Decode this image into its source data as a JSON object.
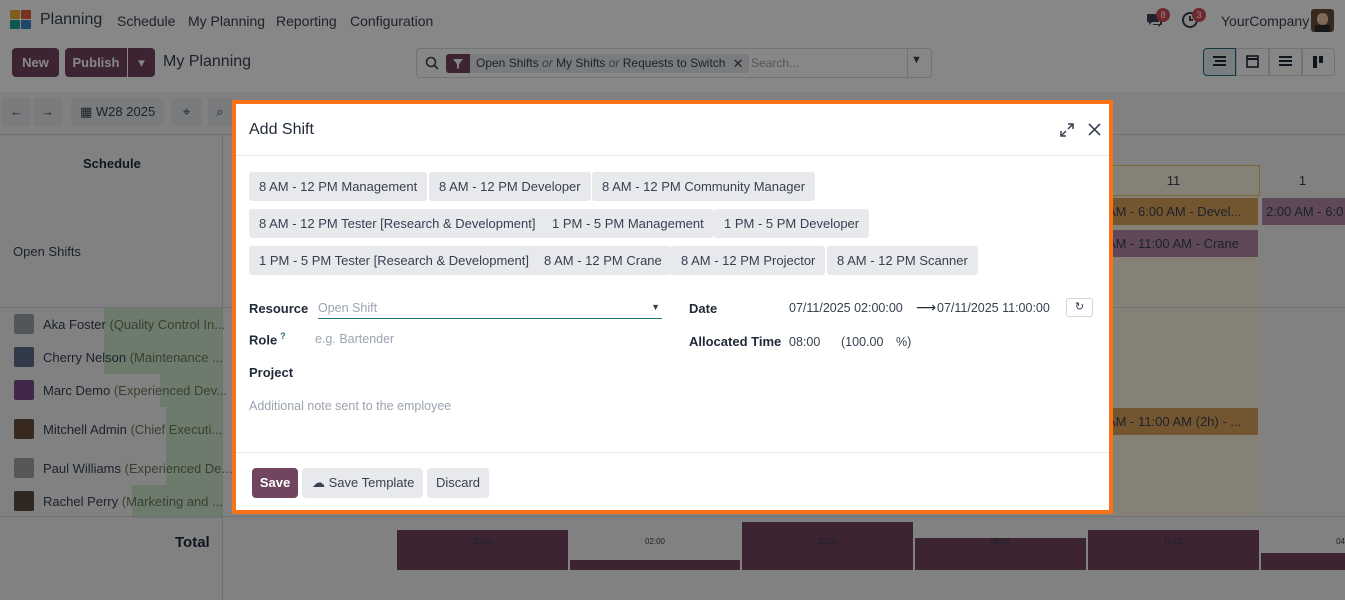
{
  "nav": {
    "app_name": "Planning",
    "menu": [
      "Schedule",
      "My Planning",
      "Reporting",
      "Configuration"
    ],
    "messages_badge": "8",
    "activities_badge": "3",
    "company": "YourCompany"
  },
  "control_panel": {
    "new_label": "New",
    "publish_label": "Publish",
    "breadcrumb": "My Planning",
    "facet": {
      "a": "Open Shifts",
      "or1": "or",
      "b": "My Shifts",
      "or2": "or",
      "c": "Requests to Switch"
    },
    "search_placeholder": "Search...",
    "week_label": "W28 2025"
  },
  "gantt": {
    "schedule_header": "Schedule",
    "day_header": "11",
    "day_header_next": "1",
    "rows": [
      {
        "name": "Open Shifts",
        "role": ""
      },
      {
        "name": "Aka Foster",
        "role": "(Quality Control In..."
      },
      {
        "name": "Cherry Nelson",
        "role": "(Maintenance ..."
      },
      {
        "name": "Marc Demo",
        "role": "(Experienced Dev..."
      },
      {
        "name": "Mitchell Admin",
        "role": "(Chief Executi..."
      },
      {
        "name": "Paul Williams",
        "role": "(Experienced De..."
      },
      {
        "name": "Rachel Perry",
        "role": "(Marketing and ..."
      }
    ],
    "pills": [
      "AM - 6:00 AM - Devel...",
      "2:00 AM - 6:0",
      "AM - 11:00 AM - Crane",
      "AM - 11:00 AM (2h) - ..."
    ],
    "total_label": "Total",
    "totals": [
      "10:00",
      "02:00",
      "12:00",
      "08:00",
      "10:00",
      "04"
    ]
  },
  "modal": {
    "title": "Add Shift",
    "templates": [
      "8 AM - 12 PM Management",
      "8 AM - 12 PM Developer",
      "8 AM - 12 PM Community Manager",
      "8 AM - 12 PM Tester [Research & Development]",
      "1 PM - 5 PM Management",
      "1 PM - 5 PM Developer",
      "1 PM - 5 PM Tester [Research & Development]",
      "8 AM - 12 PM Crane",
      "8 AM - 12 PM Projector",
      "8 AM - 12 PM Scanner"
    ],
    "resource_label": "Resource",
    "resource_placeholder": "Open Shift",
    "role_label": "Role",
    "role_help": "?",
    "role_placeholder": "e.g. Bartender",
    "project_label": "Project",
    "note_placeholder": "Additional note sent to the employee",
    "date_label": "Date",
    "date_start": "07/11/2025 02:00:00",
    "date_end": "07/11/2025 11:00:00",
    "allocated_label": "Allocated Time",
    "allocated_hours": "08:00",
    "allocated_percent": "(100.00",
    "percent_sign": "%)",
    "save_label": "Save",
    "save_template_label": "Save Template",
    "discard_label": "Discard"
  }
}
